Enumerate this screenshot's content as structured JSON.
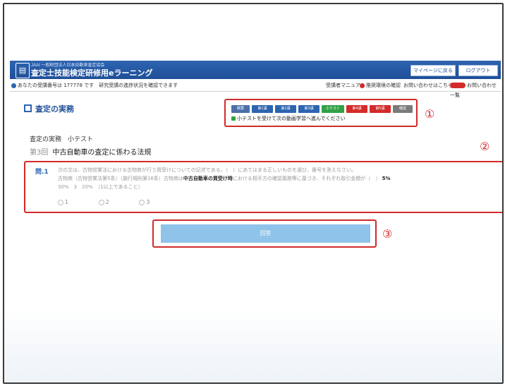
{
  "header": {
    "logo_small": "JAAI",
    "logo_tagline": "一般財団法人日本自動車査定協会",
    "title": "査定士技能検定研修用eラーニング",
    "mypage_button": "マイページに戻る",
    "logout_button": "ログアウト"
  },
  "subbar": {
    "user_info": "あなたの受講番号は 177778 です　研究受講の進捗状況を確認できます",
    "manual_link": "受講者マニュアル",
    "recommended_env": "推奨環境の確認",
    "inquiry_note": "お問い合わせはこちら",
    "faq_link": "お問い合わせ一覧"
  },
  "section": {
    "title": "査定の実務"
  },
  "nav_buttons": [
    {
      "label": "概要",
      "color": "#4a6fa8"
    },
    {
      "label": "第1講",
      "color": "#2d64b0"
    },
    {
      "label": "第2講",
      "color": "#2d64b0"
    },
    {
      "label": "第3講",
      "color": "#2d64b0"
    },
    {
      "label": "小テスト",
      "color": "#34a048"
    },
    {
      "label": "第4講",
      "color": "#d42a2a"
    },
    {
      "label": "第5講",
      "color": "#d42a2a"
    },
    {
      "label": "確認",
      "color": "#7a7a7a"
    }
  ],
  "nav_note": "小テストを受けて次の動画学習へ進んでください",
  "quiz": {
    "heading": "査定の実務　小テスト",
    "lesson_no": "第3回",
    "lesson_title": "中古自動車の査定に係わる法規",
    "question_label": "問.1",
    "question_line1": "次の文は、古物営業法における古物商が行う買受けについての記述である。（　）にあてはまる正しいものを選び、番号を答えなさい。",
    "question_line2_pre": "古物商（古物営業法第5条）（施行規則第16条）古物商は",
    "question_line2_bold": "中古自動車の買受け時",
    "question_line2_post": "における相手方の確認義務等に基づき、それぞれ取引金額が（　）",
    "question_line2_pct": "5%",
    "question_line3": "30%　3　20%　（1以上であること）",
    "options": [
      "1",
      "2",
      "3"
    ],
    "answer_button": "回答"
  },
  "annotations": [
    "①",
    "②",
    "③"
  ],
  "colors": {
    "header_blue": "#2d64b0",
    "annotation_red": "#d22a2a",
    "answer_button": "#8fc3ea"
  }
}
